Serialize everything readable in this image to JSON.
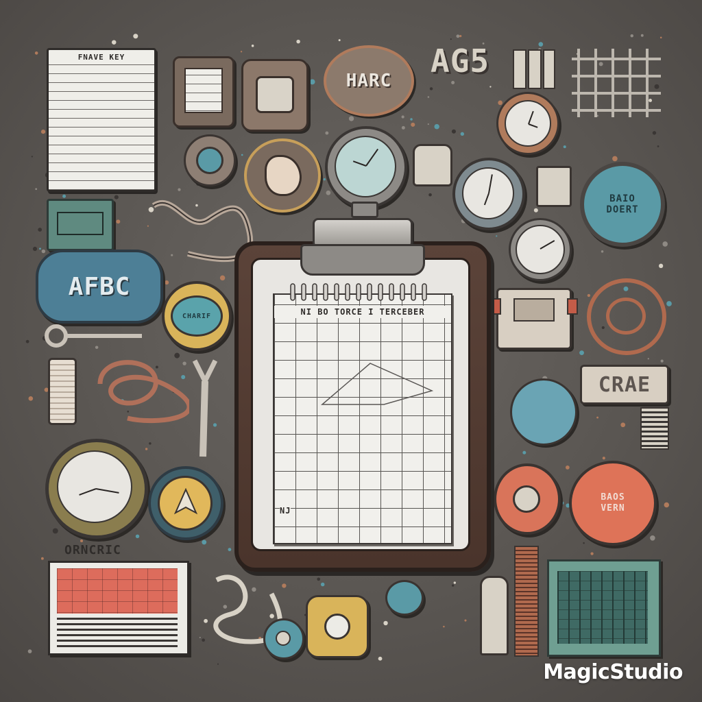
{
  "scene": {
    "description_tag": "illustration",
    "labels": {
      "top_left_sheet": "FNAVE KEY",
      "top_center_badge": "HARC",
      "top_letters": "AG5",
      "left_blue_badge": "AFBC",
      "left_teal_badge": "CHARIF",
      "right_teal_badge_line1": "BAIO",
      "right_teal_badge_line2": "DOERT",
      "clipboard_header": "NI BO TORCE I TERCEBER",
      "clipboard_side": "NJ",
      "right_plate": "CRAE",
      "bottom_left_text": "ORNCRIC",
      "orange_badge": "BAOS VERN"
    },
    "colors": {
      "background": "#5d5a57",
      "teal": "#5a9aa6",
      "coral": "#d9745a",
      "mustard": "#d9b45a",
      "cream": "#ecebe6",
      "brown": "#5a3f33"
    }
  },
  "watermark": "MagicStudio"
}
